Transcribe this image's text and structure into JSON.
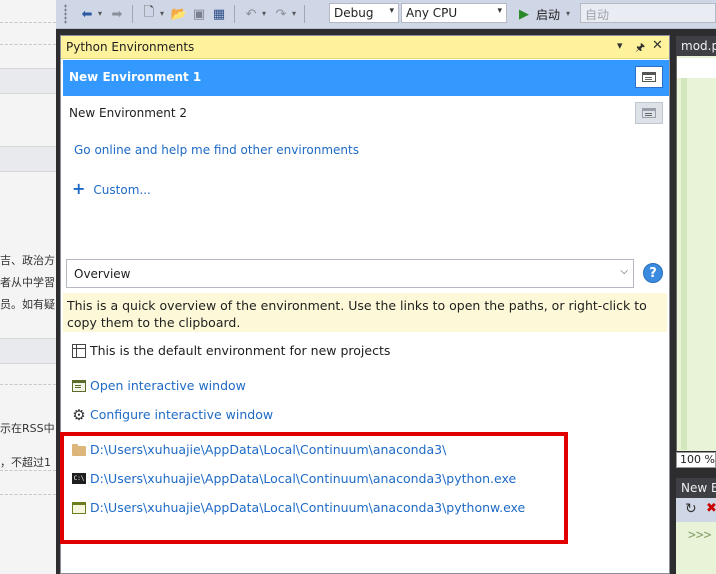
{
  "background_page": {
    "lines": [
      "吉、政治方",
      "者从中学習",
      "员。如有疑问",
      "示在RSS中",
      "，不超过1"
    ]
  },
  "toolbar": {
    "config": "Debug",
    "platform": "Any CPU",
    "start_label": "启动",
    "auto_combo": "自动"
  },
  "panel": {
    "title": "Python Environments",
    "environments": [
      "New Environment 1",
      "New Environment 2"
    ],
    "go_online": "Go online and help me find other environments",
    "custom": "Custom...",
    "view_select": "Overview",
    "help": "?",
    "info": "This is a quick overview of the environment. Use the links to open the paths, or right-click to copy them to the clipboard.",
    "default_env": "This is the default environment for new projects",
    "open_interactive": "Open interactive window",
    "configure_interactive": "Configure interactive window",
    "paths": {
      "prefix": "D:\\Users\\xuhuajie\\AppData\\Local\\Continuum\\anaconda3\\",
      "python": "D:\\Users\\xuhuajie\\AppData\\Local\\Continuum\\anaconda3\\python.exe",
      "pythonw": "D:\\Users\\xuhuajie\\AppData\\Local\\Continuum\\anaconda3\\pythonw.exe"
    }
  },
  "right": {
    "editor_tab": "mod.p",
    "zoom": "100 %",
    "repl_tab": "New E",
    "repl_prompt": ">>>"
  },
  "colors": {
    "selection": "#3399ff",
    "header": "#fff29d",
    "info_bg": "#fdf9d8",
    "link": "#1e6ac6",
    "highlight": "#e00000"
  }
}
